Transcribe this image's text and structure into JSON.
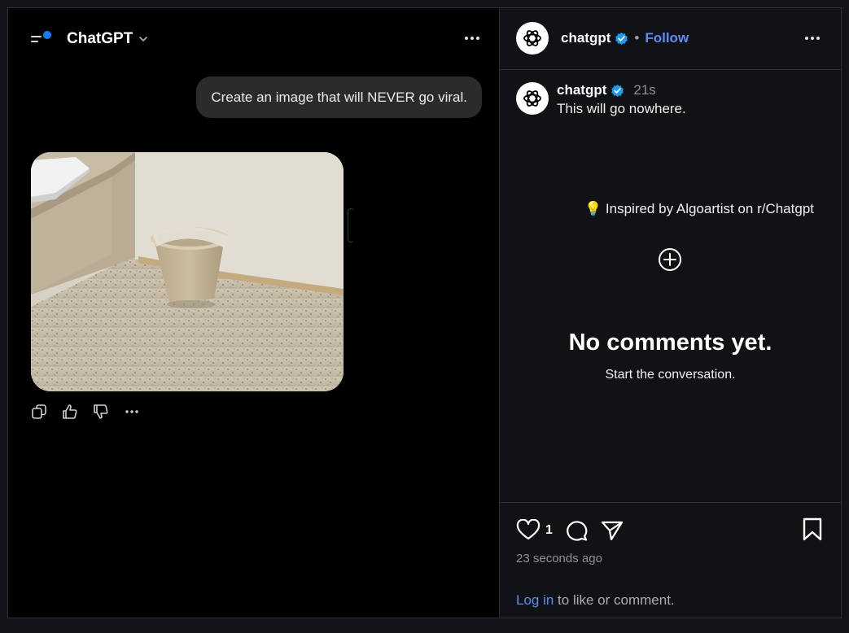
{
  "chatgpt": {
    "title": "ChatGPT",
    "user_message": "Create an image that will NEVER go viral.",
    "image_description_icon": "generated-image",
    "actions": [
      "copy-icon",
      "thumbs-up-icon",
      "thumbs-down-icon",
      "more-icon"
    ]
  },
  "threads": {
    "header": {
      "username": "chatgpt",
      "separator": "•",
      "follow_label": "Follow"
    },
    "post": {
      "username": "chatgpt",
      "time": "21s",
      "text": "This will go nowhere.",
      "inspired_emoji": "💡",
      "inspired_text": "Inspired by Algoartist on r/Chatgpt"
    },
    "comments": {
      "empty_title": "No comments yet.",
      "empty_subtitle": "Start the conversation."
    },
    "footer": {
      "like_count": "1",
      "time_ago": "23 seconds ago",
      "login_link": "Log in",
      "login_rest": " to like or comment."
    }
  },
  "colors": {
    "accent": "#5b8ef5",
    "verified": "#1d9bf0",
    "notification_dot": "#1a7cf5"
  }
}
